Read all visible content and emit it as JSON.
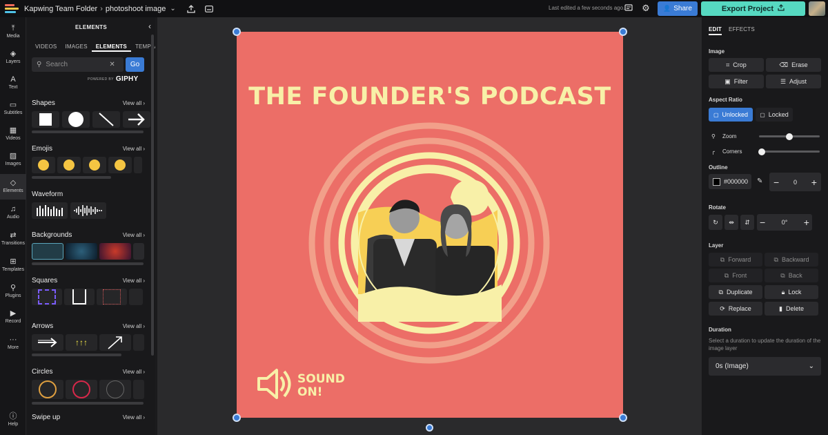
{
  "topbar": {
    "folder": "Kapwing Team Folder",
    "project": "photoshoot image",
    "last_edited": "Last edited a few seconds ago.",
    "share_label": "Share",
    "export_label": "Export Project"
  },
  "rail": {
    "items": [
      {
        "label": "Media",
        "icon": "upload-icon"
      },
      {
        "label": "Layers",
        "icon": "layers-icon"
      },
      {
        "label": "Text",
        "icon": "text-icon"
      },
      {
        "label": "Subtitles",
        "icon": "subtitles-icon"
      },
      {
        "label": "Videos",
        "icon": "film-icon"
      },
      {
        "label": "Images",
        "icon": "image-icon"
      },
      {
        "label": "Elements",
        "icon": "shapes-icon"
      },
      {
        "label": "Audio",
        "icon": "music-icon"
      },
      {
        "label": "Transitions",
        "icon": "transition-icon"
      },
      {
        "label": "Templates",
        "icon": "grid-icon"
      },
      {
        "label": "Plugins",
        "icon": "plug-icon"
      },
      {
        "label": "Record",
        "icon": "camera-icon"
      },
      {
        "label": "More",
        "icon": "dots-icon"
      },
      {
        "label": "Help",
        "icon": "help-icon"
      }
    ]
  },
  "panel": {
    "title": "ELEMENTS",
    "tabs": [
      "VIDEOS",
      "IMAGES",
      "ELEMENTS",
      "TEMPLA"
    ],
    "search_placeholder": "Search",
    "go_label": "Go",
    "powered_by": "POWERED BY",
    "giphy": "GIPHY",
    "view_all": "View all",
    "sections": [
      "Shapes",
      "Emojis",
      "Waveform",
      "Backgrounds",
      "Squares",
      "Arrows",
      "Circles",
      "Swipe up"
    ]
  },
  "canvas": {
    "title": "THE FOUNDER'S PODCAST",
    "sound_line1": "SOUND",
    "sound_line2": "ON!",
    "colors": {
      "background": "#ec6e67",
      "cream": "#f8f0a8",
      "ring": "#f2a08a",
      "yellow": "#f7cf55"
    }
  },
  "right": {
    "tabs": [
      "EDIT",
      "EFFECTS"
    ],
    "image_label": "Image",
    "crop": "Crop",
    "erase": "Erase",
    "filter": "Filter",
    "adjust": "Adjust",
    "aspect_label": "Aspect Ratio",
    "unlocked": "Unlocked",
    "locked": "Locked",
    "zoom": "Zoom",
    "corners": "Corners",
    "zoom_level": 0.5,
    "corners_level": 0.0,
    "outline_label": "Outline",
    "outline_color": "#000000",
    "outline_value": "0",
    "rotate_label": "Rotate",
    "rotate_value": "0°",
    "layer_label": "Layer",
    "forward": "Forward",
    "backward": "Backward",
    "front": "Front",
    "back": "Back",
    "duplicate": "Duplicate",
    "lock": "Lock",
    "replace": "Replace",
    "delete": "Delete",
    "duration_label": "Duration",
    "duration_desc": "Select a duration to update the duration of the image layer",
    "duration_value": "0s (Image)"
  }
}
